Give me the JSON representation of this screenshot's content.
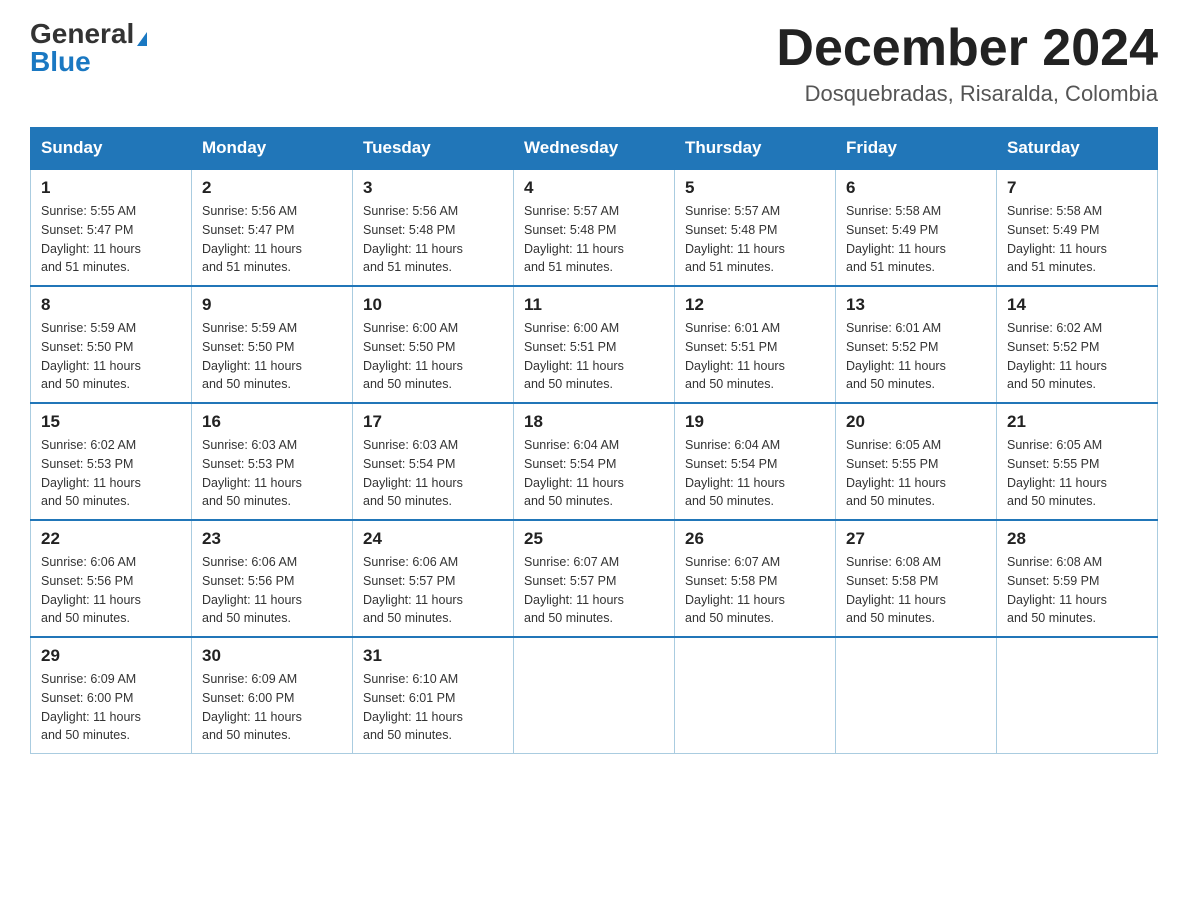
{
  "header": {
    "logo_general": "General",
    "logo_blue": "Blue",
    "month_title": "December 2024",
    "location": "Dosquebradas, Risaralda, Colombia"
  },
  "days_of_week": [
    "Sunday",
    "Monday",
    "Tuesday",
    "Wednesday",
    "Thursday",
    "Friday",
    "Saturday"
  ],
  "weeks": [
    [
      {
        "day": "1",
        "sunrise": "5:55 AM",
        "sunset": "5:47 PM",
        "daylight": "11 hours and 51 minutes."
      },
      {
        "day": "2",
        "sunrise": "5:56 AM",
        "sunset": "5:47 PM",
        "daylight": "11 hours and 51 minutes."
      },
      {
        "day": "3",
        "sunrise": "5:56 AM",
        "sunset": "5:48 PM",
        "daylight": "11 hours and 51 minutes."
      },
      {
        "day": "4",
        "sunrise": "5:57 AM",
        "sunset": "5:48 PM",
        "daylight": "11 hours and 51 minutes."
      },
      {
        "day": "5",
        "sunrise": "5:57 AM",
        "sunset": "5:48 PM",
        "daylight": "11 hours and 51 minutes."
      },
      {
        "day": "6",
        "sunrise": "5:58 AM",
        "sunset": "5:49 PM",
        "daylight": "11 hours and 51 minutes."
      },
      {
        "day": "7",
        "sunrise": "5:58 AM",
        "sunset": "5:49 PM",
        "daylight": "11 hours and 51 minutes."
      }
    ],
    [
      {
        "day": "8",
        "sunrise": "5:59 AM",
        "sunset": "5:50 PM",
        "daylight": "11 hours and 50 minutes."
      },
      {
        "day": "9",
        "sunrise": "5:59 AM",
        "sunset": "5:50 PM",
        "daylight": "11 hours and 50 minutes."
      },
      {
        "day": "10",
        "sunrise": "6:00 AM",
        "sunset": "5:50 PM",
        "daylight": "11 hours and 50 minutes."
      },
      {
        "day": "11",
        "sunrise": "6:00 AM",
        "sunset": "5:51 PM",
        "daylight": "11 hours and 50 minutes."
      },
      {
        "day": "12",
        "sunrise": "6:01 AM",
        "sunset": "5:51 PM",
        "daylight": "11 hours and 50 minutes."
      },
      {
        "day": "13",
        "sunrise": "6:01 AM",
        "sunset": "5:52 PM",
        "daylight": "11 hours and 50 minutes."
      },
      {
        "day": "14",
        "sunrise": "6:02 AM",
        "sunset": "5:52 PM",
        "daylight": "11 hours and 50 minutes."
      }
    ],
    [
      {
        "day": "15",
        "sunrise": "6:02 AM",
        "sunset": "5:53 PM",
        "daylight": "11 hours and 50 minutes."
      },
      {
        "day": "16",
        "sunrise": "6:03 AM",
        "sunset": "5:53 PM",
        "daylight": "11 hours and 50 minutes."
      },
      {
        "day": "17",
        "sunrise": "6:03 AM",
        "sunset": "5:54 PM",
        "daylight": "11 hours and 50 minutes."
      },
      {
        "day": "18",
        "sunrise": "6:04 AM",
        "sunset": "5:54 PM",
        "daylight": "11 hours and 50 minutes."
      },
      {
        "day": "19",
        "sunrise": "6:04 AM",
        "sunset": "5:54 PM",
        "daylight": "11 hours and 50 minutes."
      },
      {
        "day": "20",
        "sunrise": "6:05 AM",
        "sunset": "5:55 PM",
        "daylight": "11 hours and 50 minutes."
      },
      {
        "day": "21",
        "sunrise": "6:05 AM",
        "sunset": "5:55 PM",
        "daylight": "11 hours and 50 minutes."
      }
    ],
    [
      {
        "day": "22",
        "sunrise": "6:06 AM",
        "sunset": "5:56 PM",
        "daylight": "11 hours and 50 minutes."
      },
      {
        "day": "23",
        "sunrise": "6:06 AM",
        "sunset": "5:56 PM",
        "daylight": "11 hours and 50 minutes."
      },
      {
        "day": "24",
        "sunrise": "6:06 AM",
        "sunset": "5:57 PM",
        "daylight": "11 hours and 50 minutes."
      },
      {
        "day": "25",
        "sunrise": "6:07 AM",
        "sunset": "5:57 PM",
        "daylight": "11 hours and 50 minutes."
      },
      {
        "day": "26",
        "sunrise": "6:07 AM",
        "sunset": "5:58 PM",
        "daylight": "11 hours and 50 minutes."
      },
      {
        "day": "27",
        "sunrise": "6:08 AM",
        "sunset": "5:58 PM",
        "daylight": "11 hours and 50 minutes."
      },
      {
        "day": "28",
        "sunrise": "6:08 AM",
        "sunset": "5:59 PM",
        "daylight": "11 hours and 50 minutes."
      }
    ],
    [
      {
        "day": "29",
        "sunrise": "6:09 AM",
        "sunset": "6:00 PM",
        "daylight": "11 hours and 50 minutes."
      },
      {
        "day": "30",
        "sunrise": "6:09 AM",
        "sunset": "6:00 PM",
        "daylight": "11 hours and 50 minutes."
      },
      {
        "day": "31",
        "sunrise": "6:10 AM",
        "sunset": "6:01 PM",
        "daylight": "11 hours and 50 minutes."
      },
      null,
      null,
      null,
      null
    ]
  ],
  "labels": {
    "sunrise": "Sunrise:",
    "sunset": "Sunset:",
    "daylight": "Daylight:"
  }
}
